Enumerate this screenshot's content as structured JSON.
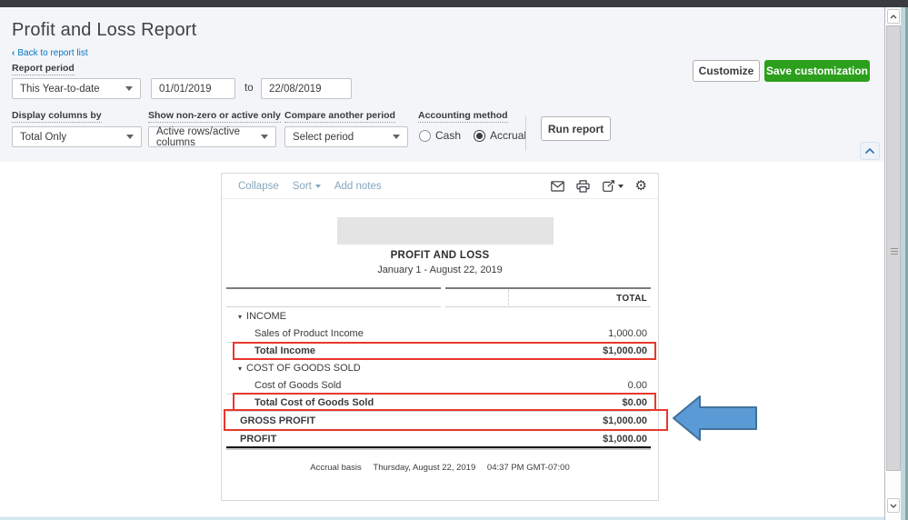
{
  "page": {
    "title": "Profit and Loss Report",
    "back_link": "Back to report list",
    "back_chevron": "‹"
  },
  "filters": {
    "report_period_label": "Report period",
    "period_value": "This Year-to-date",
    "date_from": "01/01/2019",
    "to_label": "to",
    "date_to": "22/08/2019",
    "display_columns_label": "Display columns by",
    "display_columns_value": "Total Only",
    "nonzero_label": "Show non-zero or active only",
    "nonzero_value": "Active rows/active columns",
    "compare_label": "Compare another period",
    "compare_value": "Select period",
    "accounting_method_label": "Accounting method",
    "accounting_options": [
      {
        "label": "Cash",
        "selected": false
      },
      {
        "label": "Accrual",
        "selected": true
      }
    ],
    "run_report_label": "Run report",
    "customize_label": "Customize",
    "save_customization_label": "Save customization"
  },
  "report": {
    "toolbar": {
      "collapse": "Collapse",
      "sort": "Sort",
      "add_notes": "Add notes",
      "icons": [
        "email-icon",
        "print-icon",
        "export-icon",
        "settings-gear-icon"
      ]
    },
    "header": {
      "title": "PROFIT AND LOSS",
      "subtitle": "January 1 - August 22, 2019",
      "total_column": "TOTAL"
    },
    "rows": [
      {
        "label": "INCOME",
        "value": "",
        "type": "section"
      },
      {
        "label": "Sales of Product Income",
        "value": "1,000.00",
        "type": "item"
      },
      {
        "label": "Total Income",
        "value": "$1,000.00",
        "type": "total",
        "highlighted": true
      },
      {
        "label": "COST OF GOODS SOLD",
        "value": "",
        "type": "section"
      },
      {
        "label": "Cost of Goods Sold",
        "value": "0.00",
        "type": "item"
      },
      {
        "label": "Total Cost of Goods Sold",
        "value": "$0.00",
        "type": "total",
        "highlighted": true
      },
      {
        "label": "GROSS PROFIT",
        "value": "$1,000.00",
        "type": "summary",
        "highlighted": true
      },
      {
        "label": "PROFIT",
        "value": "$1,000.00",
        "type": "summary-final"
      }
    ],
    "footer": {
      "basis": "Accrual basis",
      "date": "Thursday, August 22, 2019",
      "time": "04:37 PM GMT-07:00"
    }
  },
  "annotations": {
    "highlight_color": "#e8382d",
    "arrow": {
      "direction": "left",
      "fill": "#5b9bd5",
      "stroke": "#41719c",
      "points_at": "GROSS PROFIT row"
    }
  },
  "colors": {
    "brand_green": "#2ca01c",
    "link_blue": "#0077c5",
    "panel_gray": "#f4f5f8",
    "toolbar_link": "#84a6bc"
  }
}
